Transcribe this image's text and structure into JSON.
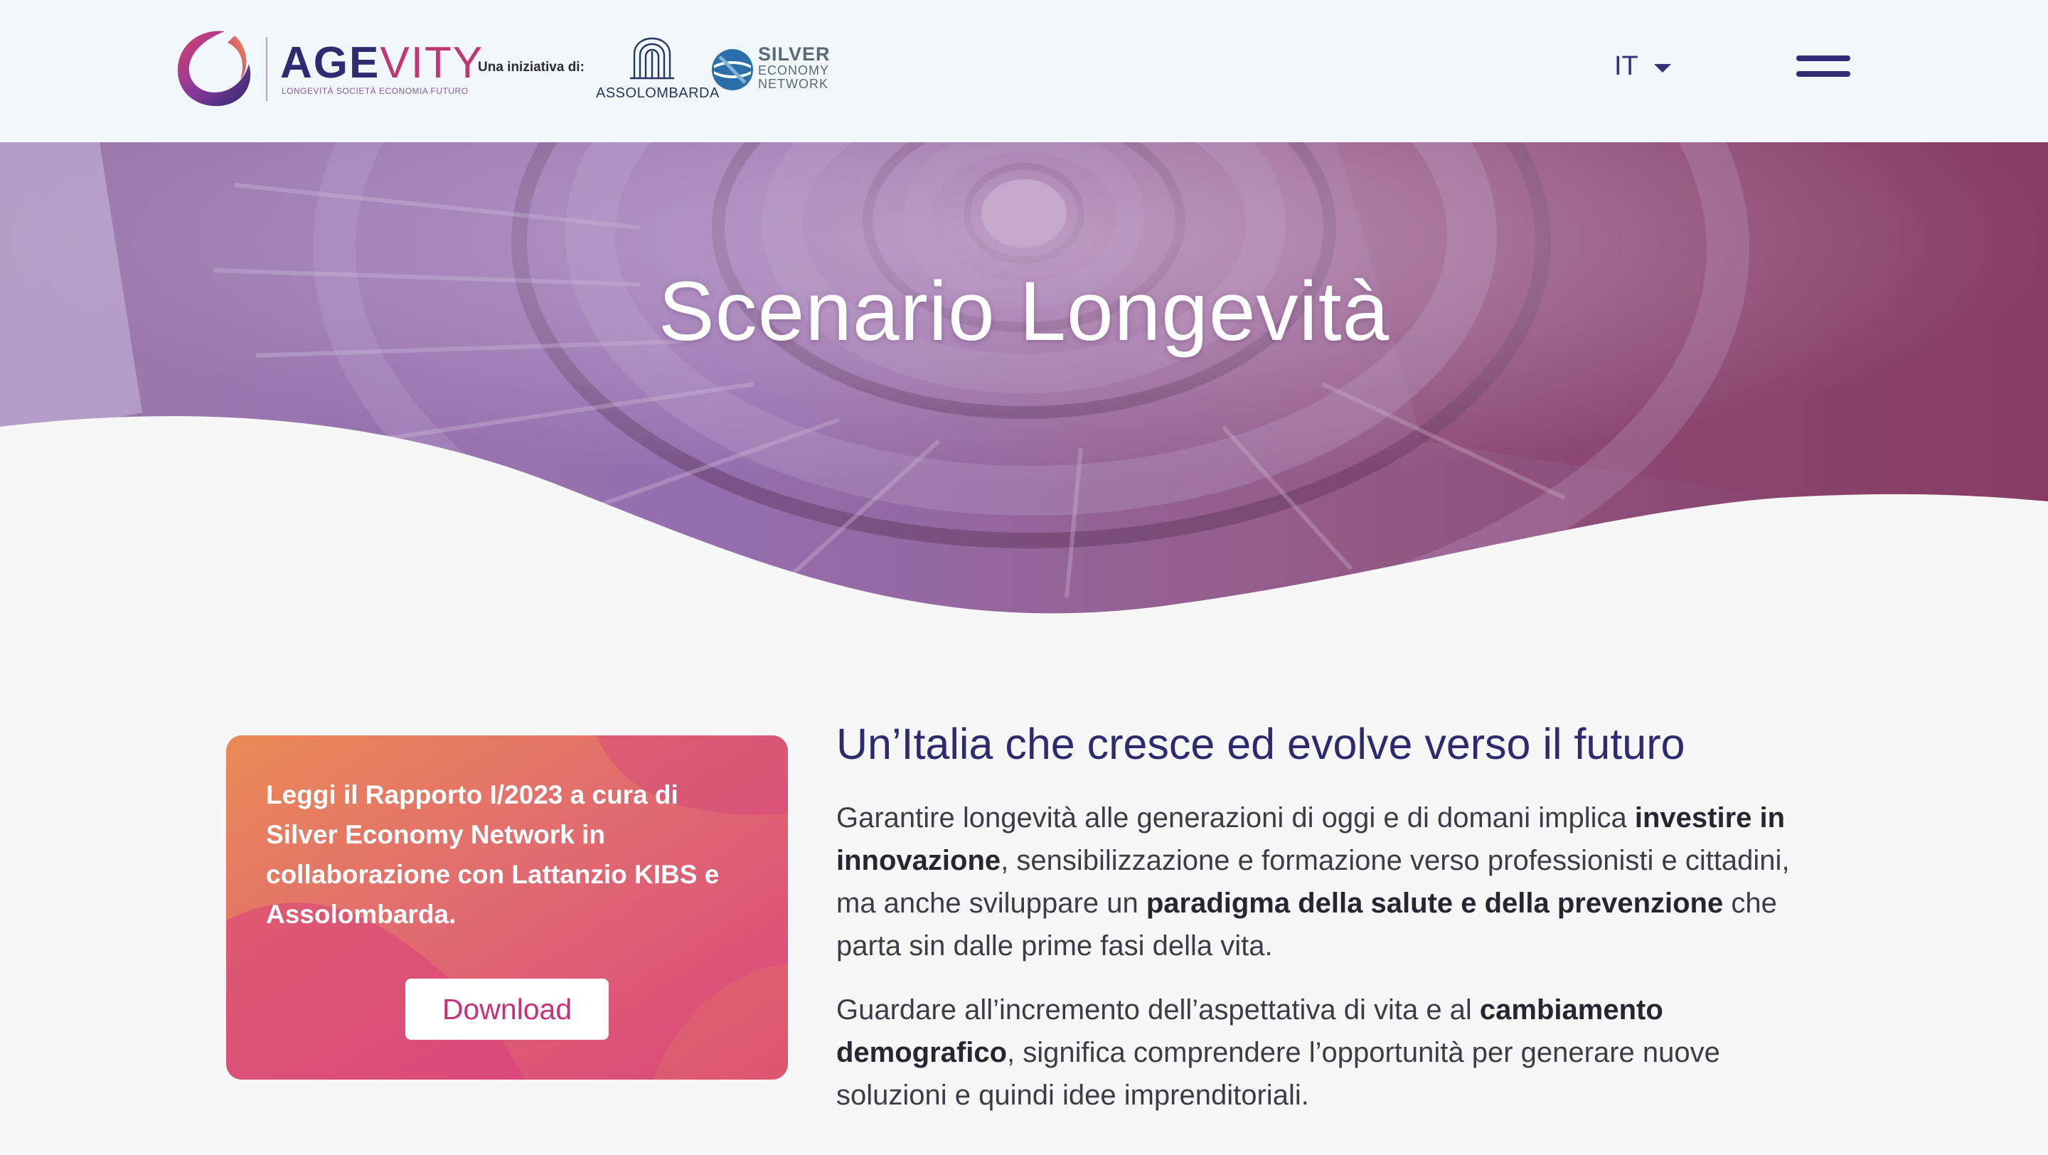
{
  "header": {
    "logo": {
      "word_part1": "AGE",
      "word_part2": "VITY",
      "tagline": "LONGEVITÀ SOCIETÀ ECONOMIA FUTURO",
      "icon": "agevity-swirl-logo"
    },
    "initiative_label": "Una iniziativa  di:",
    "partner1": {
      "name": "ASSOLOMBARDA",
      "icon": "assolombarda-shell-logo"
    },
    "partner2": {
      "line1": "SILVER",
      "line2": "ECONOMY",
      "line3": "NETWORK",
      "icon": "silver-economy-globe-logo"
    },
    "language": {
      "selected": "IT",
      "icon": "caret-down-icon"
    },
    "menu_icon": "hamburger-menu-icon"
  },
  "hero": {
    "title": "Scenario Longevità",
    "background": "spiral-staircase-photo"
  },
  "promo": {
    "text": "Leggi il Rapporto I/2023 a cura di Silver Economy Network in collaborazione con Lattanzio KIBS e Assolombarda.",
    "button_label": "Download"
  },
  "main": {
    "title": "Un’Italia che cresce ed evolve verso il futuro",
    "p1": {
      "t1": "Garantire longevità alle generazioni di oggi e di domani implica ",
      "b1": "investire in innovazione",
      "t2": ", sensibilizzazione e formazione verso professionisti e cittadini, ma anche sviluppare un ",
      "b2": "paradigma della salute e della prevenzione",
      "t3": " che parta sin dalle prime fasi della vita."
    },
    "p2": {
      "t1": "Guardare all’incremento dell’aspettativa di vita e al ",
      "b1": "cambiamento demografico",
      "t2": ", significa comprendere l’opportunità per generare nuove soluzioni e quindi idee imprenditoriali."
    }
  },
  "colors": {
    "header_bg": "#f1f7fa",
    "brand_navy": "#2f2a72",
    "brand_magenta": "#c0376f",
    "title_navy": "#2e2a6f",
    "promo_orange": "#e87a54",
    "promo_pink": "#d9457b"
  }
}
